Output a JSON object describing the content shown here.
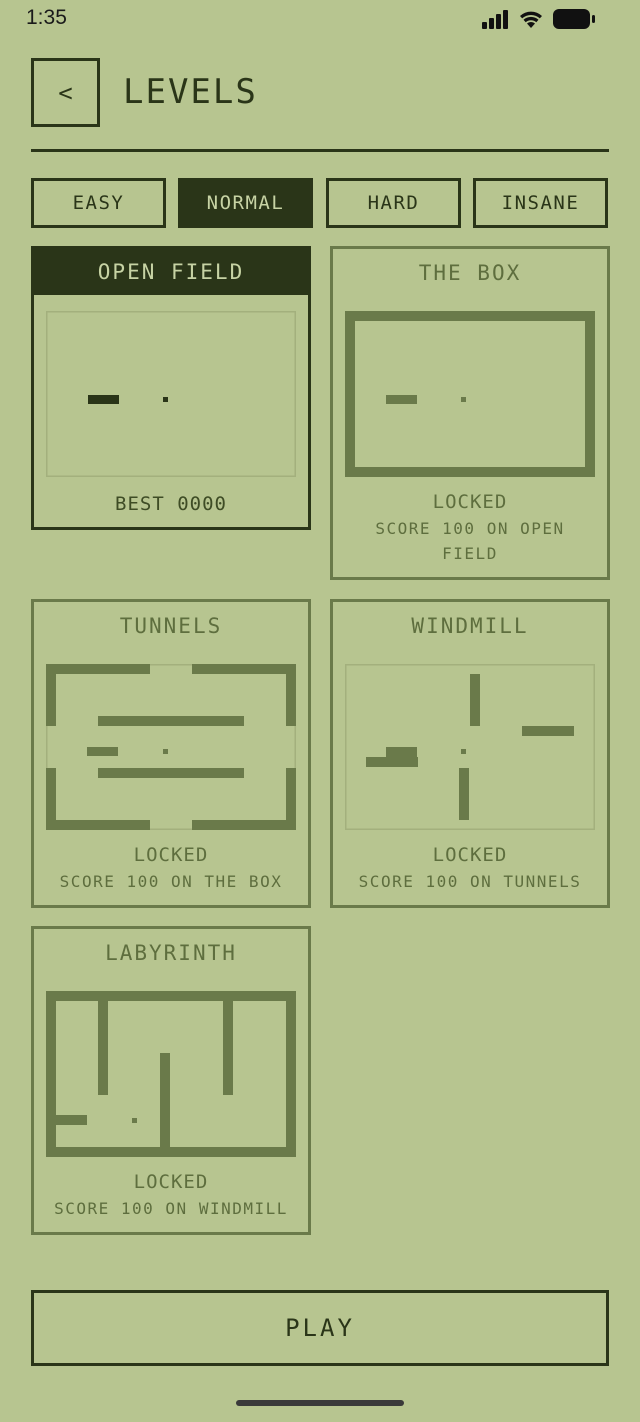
{
  "status_bar": {
    "time": "1:35"
  },
  "header": {
    "back_label": "<",
    "title": "LEVELS"
  },
  "difficulty_tabs": [
    {
      "label": "EASY",
      "active": false
    },
    {
      "label": "NORMAL",
      "active": true
    },
    {
      "label": "HARD",
      "active": false
    },
    {
      "label": "INSANE",
      "active": false
    }
  ],
  "levels": [
    {
      "name": "OPEN FIELD",
      "status": "BEST 0000",
      "selected": true,
      "locked": false
    },
    {
      "name": "THE BOX",
      "status": "LOCKED",
      "requirement_line1": "SCORE 100 ON OPEN",
      "requirement_line2": "FIELD",
      "locked": true
    },
    {
      "name": "TUNNELS",
      "status": "LOCKED",
      "requirement": "SCORE 100 ON THE BOX",
      "locked": true
    },
    {
      "name": "WINDMILL",
      "status": "LOCKED",
      "requirement": "SCORE 100 ON TUNNELS",
      "locked": true
    },
    {
      "name": "LABYRINTH",
      "status": "LOCKED",
      "requirement": "SCORE 100 ON WINDMILL",
      "locked": true
    }
  ],
  "play_label": "PLAY",
  "colors": {
    "background": "#b7c590",
    "dark": "#2a3518",
    "muted": "#6a7a4a"
  },
  "icons": [
    "signal-icon",
    "wifi-icon",
    "battery-icon"
  ]
}
